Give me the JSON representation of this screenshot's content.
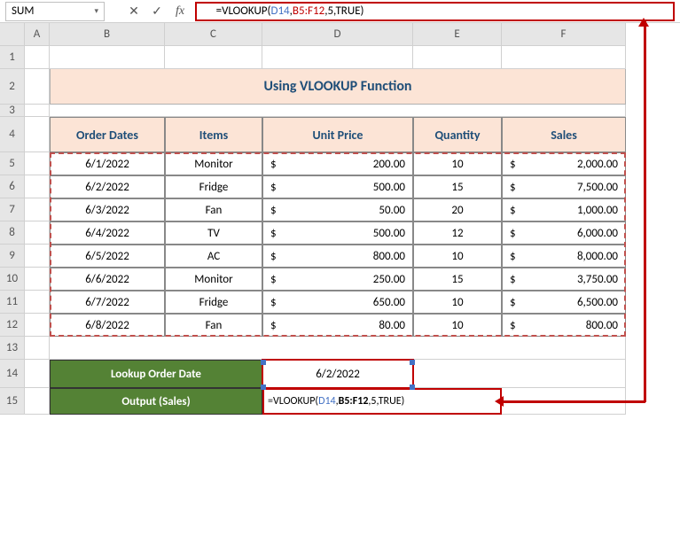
{
  "namebox": {
    "value": "SUM"
  },
  "formula_bar": {
    "eq": "=",
    "fn": "VLOOKUP(",
    "a1": "D14",
    "c1": ",",
    "a2": "B5:F12",
    "c2": ",",
    "a3": "5",
    "c3": ",",
    "a4": "TRUE",
    "close": ")"
  },
  "fx_label": "fx",
  "cancel_icon": "✕",
  "enter_icon": "✓",
  "dropdown_icon": "▾",
  "grid": {
    "cols": [
      "A",
      "B",
      "C",
      "D",
      "E",
      "F"
    ],
    "rows": [
      "1",
      "2",
      "3",
      "4",
      "5",
      "6",
      "7",
      "8",
      "9",
      "10",
      "11",
      "12",
      "13",
      "14",
      "15"
    ]
  },
  "title": "Using VLOOKUP Function",
  "headers": {
    "b": "Order Dates",
    "c": "Items",
    "d": "Unit Price",
    "e": "Quantity",
    "f": "Sales"
  },
  "currency": "$",
  "rows": [
    {
      "date": "6/1/2022",
      "item": "Monitor",
      "price": "200.00",
      "qty": "10",
      "sales": "2,000.00"
    },
    {
      "date": "6/2/2022",
      "item": "Fridge",
      "price": "500.00",
      "qty": "15",
      "sales": "7,500.00"
    },
    {
      "date": "6/3/2022",
      "item": "Fan",
      "price": "50.00",
      "qty": "20",
      "sales": "1,000.00"
    },
    {
      "date": "6/4/2022",
      "item": "TV",
      "price": "500.00",
      "qty": "12",
      "sales": "6,000.00"
    },
    {
      "date": "6/5/2022",
      "item": "AC",
      "price": "800.00",
      "qty": "10",
      "sales": "8,000.00"
    },
    {
      "date": "6/6/2022",
      "item": "Monitor",
      "price": "250.00",
      "qty": "15",
      "sales": "3,750.00"
    },
    {
      "date": "6/7/2022",
      "item": "Fridge",
      "price": "650.00",
      "qty": "10",
      "sales": "6,500.00"
    },
    {
      "date": "6/8/2022",
      "item": "Fan",
      "price": "80.00",
      "qty": "10",
      "sales": "800.00"
    }
  ],
  "lookup": {
    "date_label": "Lookup Order Date",
    "date_value": "6/2/2022",
    "output_label": "Output (Sales)",
    "output_formula": {
      "eq": "=",
      "fn": "VLOOKUP(",
      "a1": "D14",
      "c1": ",",
      "a2b": "B5:F12",
      "c2": ",5,TRUE)"
    }
  }
}
